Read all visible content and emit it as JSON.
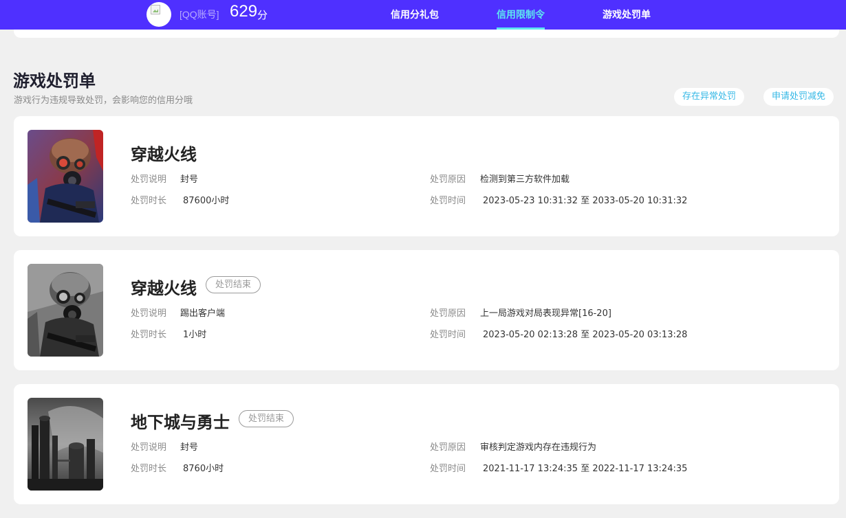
{
  "header": {
    "account_label": "[QQ账号]",
    "score": "629",
    "score_unit": "分",
    "tabs": [
      {
        "label": "信用分礼包",
        "active": false
      },
      {
        "label": "信用限制令",
        "active": true
      },
      {
        "label": "游戏处罚单",
        "active": false
      }
    ]
  },
  "section": {
    "title": "游戏处罚单",
    "subtitle": "游戏行为违规导致处罚，会影响您的信用分哦",
    "buttons": {
      "abnormal": "存在异常处罚",
      "appeal": "申请处罚减免"
    }
  },
  "field_labels": {
    "description": "处罚说明",
    "duration": "处罚时长",
    "reason": "处罚原因",
    "time": "处罚时间"
  },
  "penalties": [
    {
      "game": "穿越火线",
      "status": "",
      "description": "封号",
      "duration": "87600小时",
      "reason": "检测到第三方软件加载",
      "time": "2023-05-23 10:31:32 至 2033-05-20 10:31:32",
      "cover_icon": "soldier-gas-mask-color"
    },
    {
      "game": "穿越火线",
      "status": "处罚结束",
      "description": "踢出客户端",
      "duration": "1小时",
      "reason": "上一局游戏对局表现异常[16-20]",
      "time": "2023-05-20 02:13:28 至 2023-05-20 03:13:28",
      "cover_icon": "soldier-gas-mask-grayscale"
    },
    {
      "game": "地下城与勇士",
      "status": "处罚结束",
      "description": "封号",
      "duration": "8760小时",
      "reason": "审核判定游戏内存在违规行为",
      "time": "2021-11-17 13:24:35 至 2022-11-17 13:24:35",
      "cover_icon": "industrial-city-grayscale"
    }
  ],
  "colors": {
    "topbar": "#4f30ff",
    "active_tab": "#5ee6f0",
    "pill_text": "#35b8e6",
    "background": "#f0f0f0"
  }
}
